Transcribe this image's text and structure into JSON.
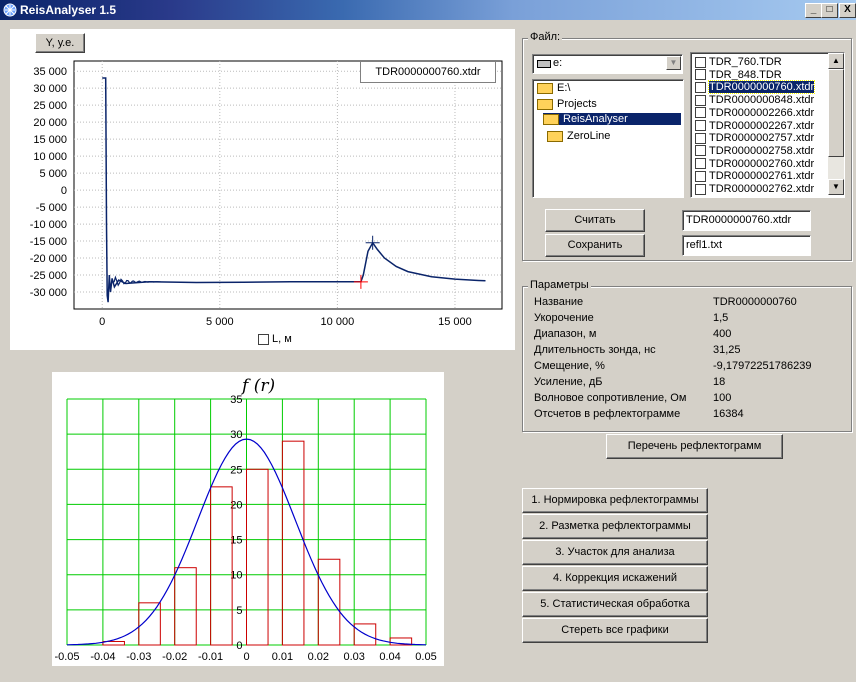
{
  "window": {
    "title": "ReisAnalyser 1.5",
    "min": "_",
    "max": "□",
    "close": "X"
  },
  "chart_top": {
    "title_button": "Y, у.е.",
    "file_label": "TDR0000000760.xtdr",
    "x_axis_checkbox_label": "L, м",
    "chart_data": {
      "type": "line",
      "ylabel": "Y, у.е.",
      "xlabel": "L, м",
      "yticks": [
        "35 000",
        "30 000",
        "25 000",
        "20 000",
        "15 000",
        "10 000",
        "5 000",
        "0",
        "-5 000",
        "-10 000",
        "-15 000",
        "-20 000",
        "-25 000",
        "-30 000"
      ],
      "xticks": [
        "0",
        "5 000",
        "10 000",
        "15 000"
      ],
      "ylim": [
        -35000,
        38000
      ],
      "xlim": [
        -1200,
        17000
      ],
      "x": [
        0,
        150,
        180,
        210,
        250,
        300,
        350,
        420,
        520,
        700,
        1000,
        2000,
        4000,
        6000,
        8000,
        10000,
        11000,
        11100,
        11300,
        11500,
        11700,
        12000,
        12500,
        13000,
        14000,
        15000,
        16000,
        16300
      ],
      "y": [
        33000,
        33000,
        -10000,
        -31000,
        -33000,
        -25000,
        -30000,
        -26000,
        -28500,
        -26500,
        -27500,
        -27000,
        -27200,
        -27100,
        -27000,
        -27000,
        -27000,
        -25000,
        -18000,
        -15500,
        -17500,
        -20000,
        -22500,
        -24000,
        -25500,
        -26200,
        -26600,
        -26700
      ],
      "markers": [
        {
          "x": 11500,
          "y": -15500,
          "color": "#0a246a"
        },
        {
          "x": 11000,
          "y": -27000,
          "color": "#ff0000"
        }
      ]
    }
  },
  "chart_bottom": {
    "title": "f (r)",
    "chart_data": {
      "type": "bar",
      "xticks": [
        "-0.05",
        "-0.04",
        "-0.03",
        "-0.02",
        "-0.01",
        "0",
        "0.01",
        "0.02",
        "0.03",
        "0.04",
        "0.05"
      ],
      "yticks": [
        "0",
        "5",
        "10",
        "15",
        "20",
        "25",
        "30",
        "35"
      ],
      "xlim": [
        -0.05,
        0.05
      ],
      "ylim": [
        0,
        35
      ],
      "bins_left": [
        -0.04,
        -0.03,
        -0.02,
        -0.01,
        0,
        0.01,
        0.02,
        0.03,
        0.04
      ],
      "bin_width": 0.006,
      "values": [
        0.5,
        6.0,
        11.0,
        22.5,
        25.0,
        29.0,
        12.2,
        3.0,
        1.0
      ],
      "curve": {
        "mean": 0.0,
        "sigma": 0.0136,
        "peak": 29.3
      }
    }
  },
  "file_panel": {
    "group_label": "Файл:",
    "drive": "e:",
    "folders": [
      "E:\\",
      "Projects",
      "ReisAnalyser",
      "ZeroLine"
    ],
    "selected_folder": 2,
    "files": [
      "TDR_760.TDR",
      "TDR_848.TDR",
      "TDR0000000760.xtdr",
      "TDR0000000848.xtdr",
      "TDR0000002266.xtdr",
      "TDR0000002267.xtdr",
      "TDR0000002757.xtdr",
      "TDR0000002758.xtdr",
      "TDR0000002760.xtdr",
      "TDR0000002761.xtdr",
      "TDR0000002762.xtdr"
    ],
    "selected_file": 2,
    "read_button": "Считать",
    "save_button": "Сохранить",
    "read_value": "TDR0000000760.xtdr",
    "save_value": "refl1.txt"
  },
  "params": {
    "group_label": "Параметры",
    "rows": [
      {
        "label": "Название",
        "value": "TDR0000000760"
      },
      {
        "label": "Укорочение",
        "value": "1,5"
      },
      {
        "label": "Диапазон, м",
        "value": "400"
      },
      {
        "label": "Длительность  зонда, нс",
        "value": "31,25"
      },
      {
        "label": "Смещение, %",
        "value": "-9,17972251786239"
      },
      {
        "label": "Усиление, дБ",
        "value": "18"
      },
      {
        "label": "Волновое сопротивление, Ом",
        "value": "100"
      },
      {
        "label": "Отсчетов в рефлектограмме",
        "value": "16384"
      }
    ]
  },
  "list_button": "Перечень рефлектограмм",
  "actions": [
    "1. Нормировка рефлектограммы",
    "2. Разметка рефлектограммы",
    "3. Участок для анализа",
    "4. Коррекция искажений",
    "5. Статистическая обработка",
    "Стереть все графики"
  ],
  "colors": {
    "trace": "#0a246a",
    "grid": "#00cc00",
    "bars": "#cc0000",
    "curve": "#0000cc",
    "selection": "#0a246a"
  }
}
